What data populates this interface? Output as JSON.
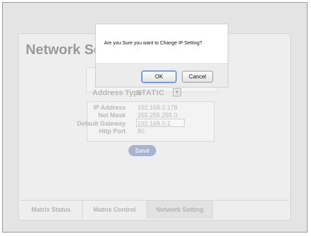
{
  "page": {
    "title": "Network Sett",
    "address_type": {
      "label": "Address Type",
      "value": "STATIC"
    },
    "network": {
      "ip_address_label": "IP Address",
      "ip_address_value": "192.168.0.178",
      "net_mask_label": "Net Mask",
      "net_mask_value": "255.255.255.0",
      "default_gateway_label": "Default Gateway",
      "default_gateway_value": "192.168.0.1",
      "http_port_label": "Http Port",
      "http_port_value": "80"
    },
    "save_label": "Save",
    "tabs": [
      {
        "label": "Matrix Status"
      },
      {
        "label": "Matrix Control"
      },
      {
        "label": "Network Setting"
      }
    ]
  },
  "dialog": {
    "message": "Are you Sure you want to Change IP Setting?",
    "ok_label": "OK",
    "cancel_label": "Cancel"
  },
  "icons": {
    "dropdown": "chevron-down-icon"
  },
  "colors": {
    "save_button": "#a5b4d0",
    "ok_focus": "#3d7bd6"
  }
}
